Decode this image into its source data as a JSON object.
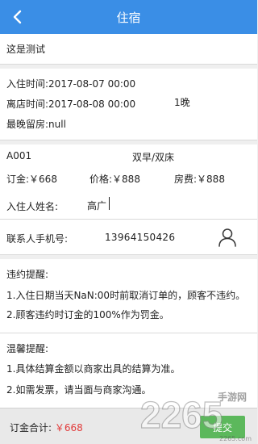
{
  "header": {
    "title": "住宿"
  },
  "hotel": {
    "name": "这是测试"
  },
  "dates": {
    "checkin": "入住时间:2017-08-07 00:00",
    "checkout": "离店时间:2017-08-08 00:00",
    "latest": "最晚留房:null",
    "nights": "1晚"
  },
  "room": {
    "code": "A001",
    "type": "双早/双床",
    "deposit": "订金:￥668",
    "price": "价格:￥888",
    "room_fee": "房费:￥888",
    "guest_label": "入住人姓名:",
    "guest_value": "高广"
  },
  "contact": {
    "label": "联系人手机号:",
    "phone": "13964150426"
  },
  "policy": {
    "title": "违约提醒:",
    "items": [
      "1.入住日期当天NaN:00时前取消订单的，顾客不违约。",
      "2.顾客违约时订金的100%作为罚金。"
    ]
  },
  "tips": {
    "title": "温馨提醒:",
    "items": [
      "1.具体结算金额以商家出具的结算为准。",
      "2.如需发票，请当面与商家沟通。"
    ]
  },
  "footer": {
    "total_label": "订金合计:",
    "total_amount": "￥668",
    "submit": "提交"
  },
  "watermark": {
    "text": "2265",
    "site": "手游网",
    "url": "2265.com"
  },
  "colors": {
    "header": "#3a8ee6",
    "submit": "#5cb85c",
    "amount": "#e23a3a"
  }
}
